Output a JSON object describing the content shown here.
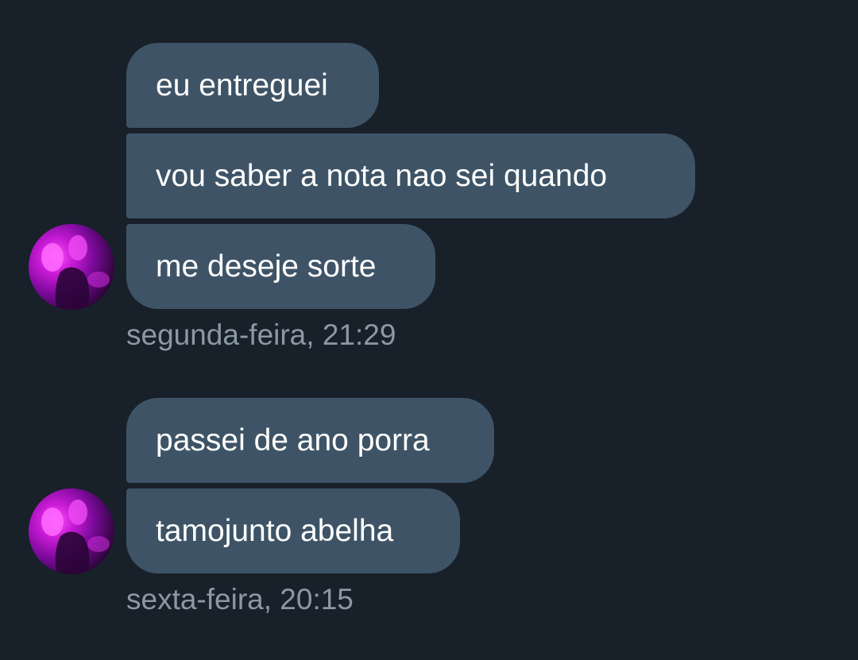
{
  "conversation": {
    "groups": [
      {
        "messages": [
          {
            "text": "eu entreguei"
          },
          {
            "text": "vou saber a nota nao sei quando"
          },
          {
            "text": "me deseje sorte"
          }
        ],
        "timestamp": "segunda-feira, 21:29"
      },
      {
        "messages": [
          {
            "text": "passei de ano porra"
          },
          {
            "text": "tamojunto abelha"
          }
        ],
        "timestamp": "sexta-feira, 20:15"
      }
    ]
  },
  "colors": {
    "background": "#18202a",
    "bubble": "#3e5466",
    "message_text": "#ffffff",
    "timestamp_text": "#8b98a5",
    "avatar_accent": "#e020f0"
  },
  "icons": {
    "avatar": "profile-avatar"
  }
}
